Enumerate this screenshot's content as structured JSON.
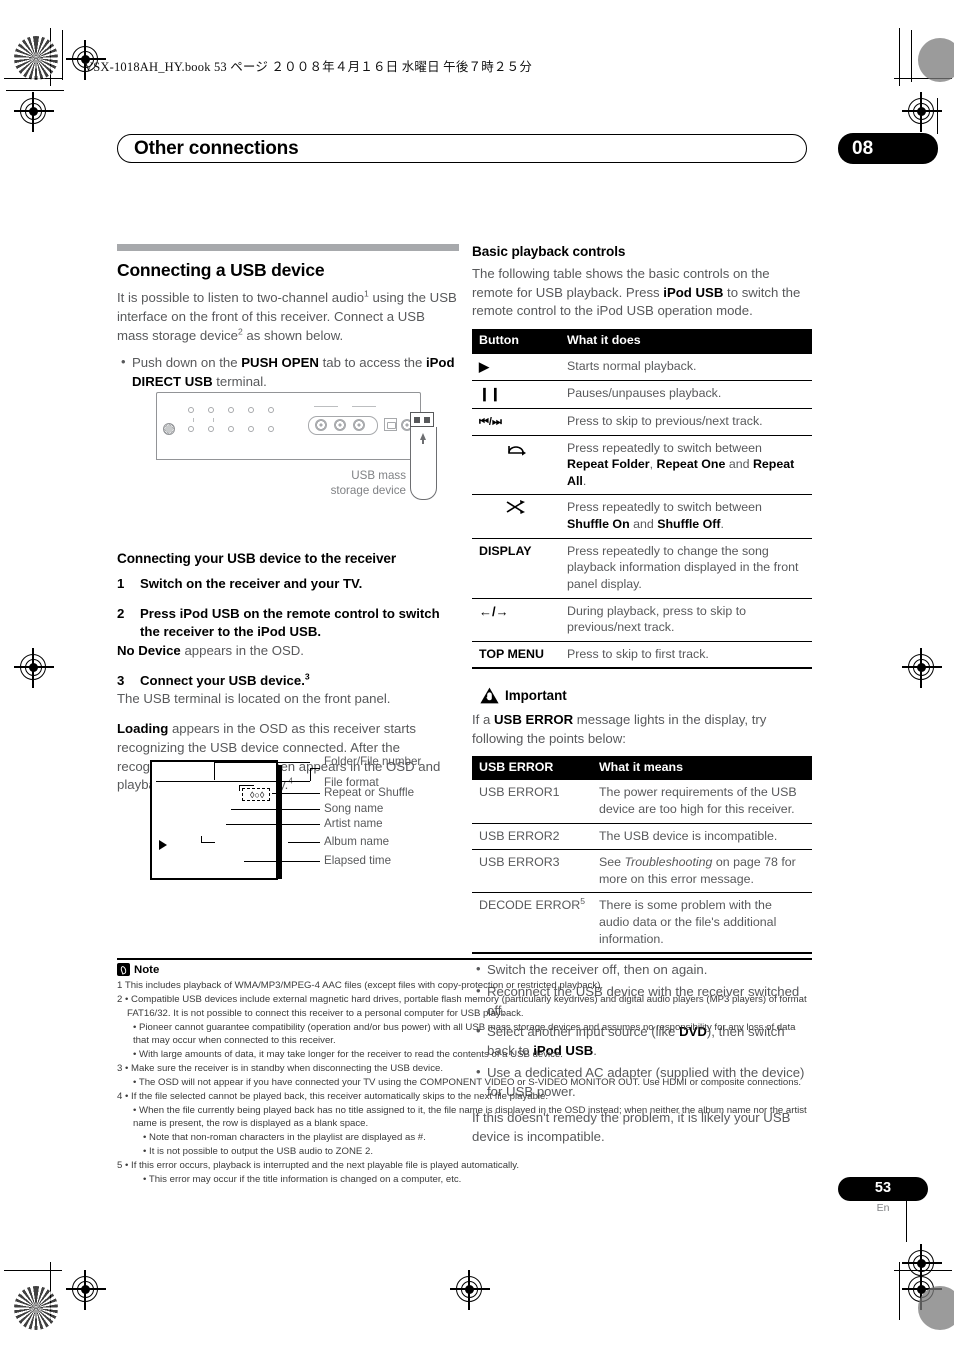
{
  "print_header": "VSX-1018AH_HY.book   53 ページ   ２００８年４月１６日   水曜日   午後７時２５分",
  "chapter": {
    "title": "Other connections",
    "number": "08"
  },
  "left": {
    "heading": "Connecting a USB device",
    "intro_1": "It is possible to listen to two-channel audio",
    "intro_1_sup": "1",
    "intro_2": " using the USB interface on the front of this receiver. Connect a USB mass storage device",
    "intro_2_sup": "2",
    "intro_3": " as shown below.",
    "bullet_1_a": "Push down on the ",
    "bullet_1_b": "PUSH OPEN",
    "bullet_1_c": " tab to access the ",
    "bullet_1_d": "iPod DIRECT USB",
    "bullet_1_e": " terminal.",
    "receiver_figure": {
      "caption": "USB mass\nstorage device",
      "caption_line1": "USB mass",
      "caption_line2": "storage device"
    },
    "subheading": "Connecting your USB device to the receiver",
    "steps": [
      {
        "num": "1",
        "title": "Switch on the receiver and your TV.",
        "sub": ""
      },
      {
        "num": "2",
        "title": "Press iPod USB on the remote control to switch the receiver to the iPod USB.",
        "sub_bold": "No Device",
        "sub_rest": " appears in the OSD."
      },
      {
        "num": "3",
        "title": "Connect your USB device.",
        "title_sup": "3",
        "sub": "The USB terminal is located on the front panel."
      }
    ],
    "loading_bold": "Loading",
    "loading_rest": " appears in the OSD as this receiver starts recognizing the USB device connected. After the recognition, a playback screen appears in the OSD and playback starts automatically.",
    "loading_sup": "4",
    "osd_labels": [
      "Folder/File number",
      "File format",
      "Repeat or Shuffle",
      "Song name",
      "Artist name",
      "Album name",
      "Elapsed time"
    ]
  },
  "right": {
    "heading": "Basic playback controls",
    "intro_a": "The following table shows the basic controls on the remote for USB playback. Press ",
    "intro_b": "iPod USB",
    "intro_c": " to switch the remote control to the iPod USB operation mode.",
    "controls_table": {
      "headers": [
        "Button",
        "What it does"
      ],
      "rows": [
        {
          "button_glyph": "▶",
          "button_kind": "glyph",
          "text": "Starts normal playback."
        },
        {
          "button_glyph": "❙❙",
          "button_kind": "glyph",
          "text": "Pauses/unpauses playback."
        },
        {
          "button_glyph": "◀◀/▶▶",
          "button_kind": "glyph",
          "text": "Press to skip to previous/next track."
        },
        {
          "button_glyph": "repeat-icon",
          "button_kind": "icon",
          "text_a": "Press repeatedly to switch between ",
          "text_b1": "Repeat Folder",
          "text_sep1": ", ",
          "text_b2": "Repeat One",
          "text_sep2": " and ",
          "text_b3": "Repeat All",
          "text_end": "."
        },
        {
          "button_glyph": "shuffle-icon",
          "button_kind": "icon",
          "text_a": "Press repeatedly to switch between ",
          "text_b1": "Shuffle On",
          "text_sep1": " and ",
          "text_b2": "Shuffle Off",
          "text_end": "."
        },
        {
          "button_glyph": "DISPLAY",
          "button_kind": "label",
          "text": "Press repeatedly to change the song playback information displayed in the front panel display."
        },
        {
          "button_glyph": "←/→",
          "button_kind": "glyph",
          "text": "During playback, press to skip to previous/next track."
        },
        {
          "button_glyph": "TOP MENU",
          "button_kind": "label",
          "text": "Press to skip to first track."
        }
      ]
    },
    "important": {
      "title": "Important",
      "intro_a": "If a ",
      "intro_b": "USB ERROR",
      "intro_c": " message lights in the display, try following the points below:"
    },
    "error_table": {
      "headers": [
        "USB ERROR",
        "What it means"
      ],
      "rows": [
        {
          "code": "USB ERROR1",
          "meaning": "The power requirements of the USB device are too high for this receiver."
        },
        {
          "code": "USB ERROR2",
          "meaning": "The USB device is incompatible."
        },
        {
          "code": "USB ERROR3",
          "meaning_a": "See ",
          "meaning_i": "Troubleshooting",
          "meaning_b": " on page 78 for more on this error message."
        },
        {
          "code": "DECODE ERROR",
          "code_sup": "5",
          "meaning": "There is some problem with the audio data or the file's additional information."
        }
      ]
    },
    "tips": [
      {
        "text": "Switch the receiver off, then on again."
      },
      {
        "text": "Reconnect the USB device with the receiver switched off."
      },
      {
        "a": "Select another input source (like ",
        "b1": "DVD",
        "c": "), then switch back to ",
        "b2": "iPod USB",
        "d": "."
      },
      {
        "text": "Use a dedicated AC adapter (supplied with the device) for USB power."
      }
    ],
    "closing": "If this doesn't remedy the problem, it is likely your USB device is incompatible."
  },
  "notes": {
    "title": "Note",
    "lines": [
      "1 This includes playback of WMA/MP3/MPEG-4 AAC files (except files with copy-protection or restricted playback).",
      "2 • Compatible USB devices include external magnetic hard drives, portable flash memory (particularly keydrives) and digital audio players (MP3 players) of format FAT16/32. It is not possible to connect this receiver to a personal computer for USB playback.",
      "• Pioneer cannot guarantee compatibility (operation and/or bus power) with all USB mass storage devices and assumes no responsibility for any loss of data that may occur when connected to this receiver.",
      "• With large amounts of data, it may take longer for the receiver to read the contents of a USB device.",
      "3 • Make sure the receiver is in standby when disconnecting the USB device.",
      "• The OSD will not appear if you have connected your TV using the COMPONENT VIDEO or S-VIDEO MONITOR OUT. Use HDMI or composite connections.",
      "4 • If the file selected cannot be played back, this receiver automatically skips to the next file playable.",
      "• When the file currently being played back has no title assigned to it, the file name is displayed in the OSD instead; when neither the album name nor the artist name is present, the row is displayed as a blank space.",
      "• Note that non-roman characters in the playlist are displayed as #.",
      "• It is not possible to output the USB audio to ZONE 2.",
      "5 • If this error occurs, playback is interrupted and the next playable file is played automatically.",
      "• This error may occur if the title information is changed on a computer, etc."
    ]
  },
  "footer": {
    "page": "53",
    "lang": "En"
  }
}
